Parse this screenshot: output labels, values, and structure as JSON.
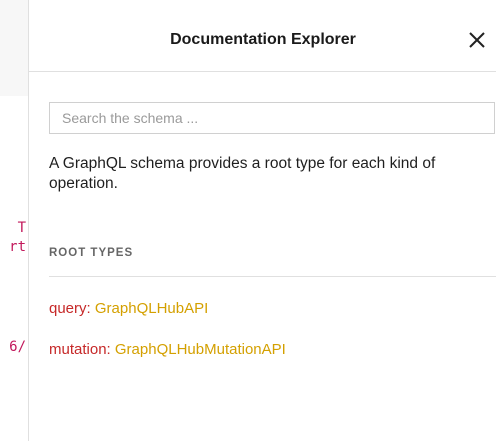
{
  "editor": {
    "line1": "T",
    "line2": "rt",
    "line3": "6/"
  },
  "doc_explorer": {
    "title": "Documentation Explorer",
    "close_icon": "close-icon",
    "search": {
      "placeholder": "Search the schema ...",
      "value": ""
    },
    "description": "A GraphQL schema provides a root type for each kind of operation.",
    "section_title": "ROOT TYPES",
    "root_types": [
      {
        "field": "query",
        "separator": ": ",
        "type": "GraphQLHubAPI"
      },
      {
        "field": "mutation",
        "separator": ": ",
        "type": "GraphQLHubMutationAPI"
      }
    ]
  },
  "colors": {
    "field": "#c62828",
    "type": "#d4a000",
    "code": "#c2185b"
  }
}
